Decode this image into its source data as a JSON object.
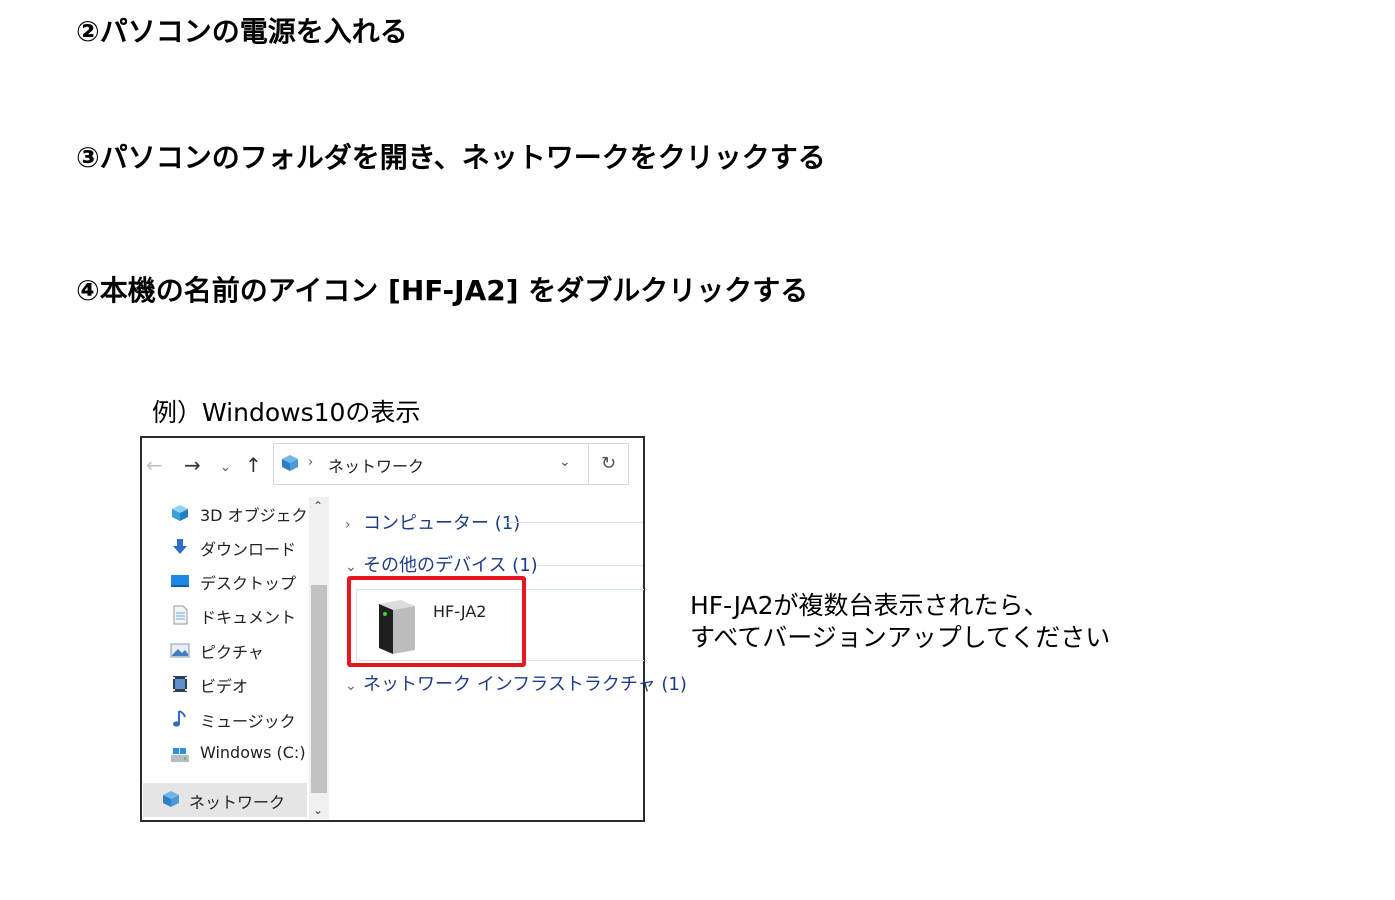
{
  "steps": {
    "step2": "②パソコンの電源を入れる",
    "step3": "③パソコンのフォルダを開き、ネットワークをクリックする",
    "step4": "④本機の名前のアイコン [HF-JA2] をダブルクリックする"
  },
  "example_label": "例）Windows10の表示",
  "explorer": {
    "nav_buttons": {
      "back": "←",
      "forward": "→",
      "recent": "⌄",
      "up": "↑"
    },
    "address": {
      "separator": "›",
      "path": "ネットワーク",
      "dropdown": "⌄",
      "refresh": "↻"
    },
    "nav_items": [
      {
        "icon": "3d-objects-icon",
        "label": "3D オブジェクト"
      },
      {
        "icon": "download-icon",
        "label": "ダウンロード"
      },
      {
        "icon": "desktop-icon",
        "label": "デスクトップ"
      },
      {
        "icon": "documents-icon",
        "label": "ドキュメント"
      },
      {
        "icon": "pictures-icon",
        "label": "ピクチャ"
      },
      {
        "icon": "videos-icon",
        "label": "ビデオ"
      },
      {
        "icon": "music-icon",
        "label": "ミュージック"
      },
      {
        "icon": "drive-icon",
        "label": "Windows (C:)"
      }
    ],
    "nav_selected": {
      "icon": "network-icon",
      "label": "ネットワーク"
    },
    "scroll": {
      "up": "⌃",
      "down": "⌄"
    },
    "groups": [
      {
        "chevron": "›",
        "label": "コンピューター (1)"
      },
      {
        "chevron": "⌄",
        "label": "その他のデバイス (1)"
      },
      {
        "chevron": "⌄",
        "label": "ネットワーク インフラストラクチャ (1)"
      }
    ],
    "device": {
      "icon": "device-icon",
      "label": "HF-JA2"
    },
    "highlight_color": "#e8161f",
    "accent_color": "#1e3c8c"
  },
  "note": {
    "line1": "HF-JA2が複数台表示されたら、",
    "line2": "すべてバージョンアップしてください"
  }
}
